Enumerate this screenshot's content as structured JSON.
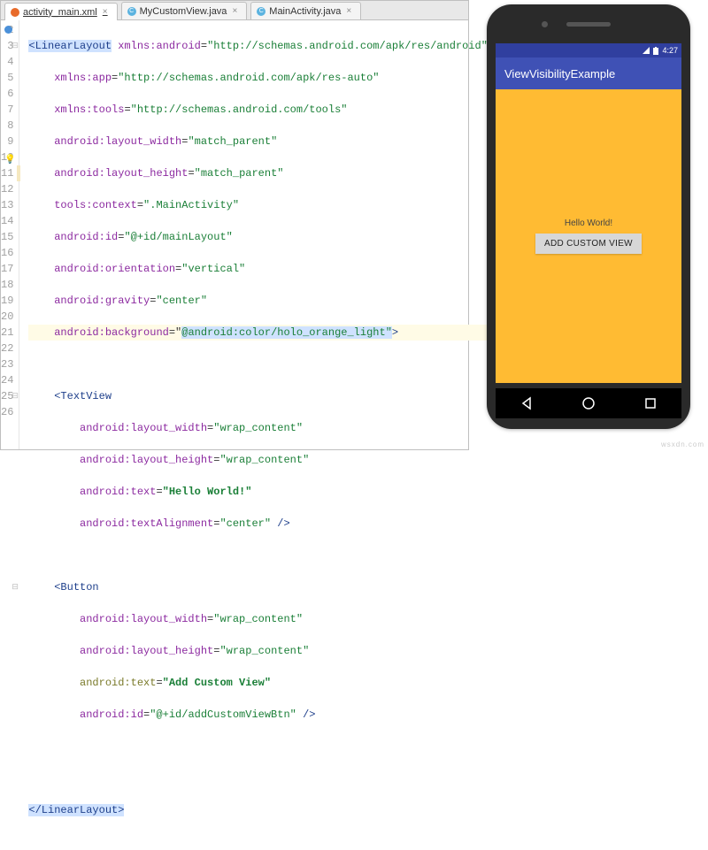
{
  "tabs": [
    {
      "label": "activity_main.xml",
      "icon": "xml",
      "active": true,
      "closable": true
    },
    {
      "label": "MyCustomView.java",
      "icon": "java",
      "active": false,
      "closable": true
    },
    {
      "label": "MainActivity.java",
      "icon": "java",
      "active": false,
      "closable": true
    }
  ],
  "gutter_start": 2,
  "gutter_end": 26,
  "code": {
    "l2": {
      "open": "<LinearLayout",
      "a1": "xmlns:android",
      "v1": "\"http://schemas.android.com/apk/res/android\""
    },
    "l3": {
      "a": "xmlns:app",
      "v": "\"http://schemas.android.com/apk/res-auto\""
    },
    "l4": {
      "a": "xmlns:tools",
      "v": "\"http://schemas.android.com/tools\""
    },
    "l5": {
      "a": "android:layout_width",
      "v": "\"match_parent\""
    },
    "l6": {
      "a": "android:layout_height",
      "v": "\"match_parent\""
    },
    "l7": {
      "a": "tools:context",
      "v": "\".MainActivity\""
    },
    "l8": {
      "a": "android:id",
      "v": "\"@+id/mainLayout\""
    },
    "l9": {
      "a": "android:orientation",
      "v": "\"vertical\""
    },
    "l10": {
      "a": "android:gravity",
      "v": "\"center\""
    },
    "l11": {
      "a": "android:background",
      "eq": "=\"",
      "v": "@android:color/holo_orange_light\"",
      "tail": ">"
    },
    "l13": {
      "open": "<TextView"
    },
    "l14": {
      "a": "android:layout_width",
      "v": "\"wrap_content\""
    },
    "l15": {
      "a": "android:layout_height",
      "v": "\"wrap_content\""
    },
    "l16": {
      "a": "android:text",
      "v": "\"Hello World!\""
    },
    "l17": {
      "a": "android:textAlignment",
      "v": "\"center\"",
      "end": " />"
    },
    "l19": {
      "open": "<Button"
    },
    "l20": {
      "a": "android:layout_width",
      "v": "\"wrap_content\""
    },
    "l21": {
      "a": "android:layout_height",
      "v": "\"wrap_content\""
    },
    "l22": {
      "a": "android:text",
      "v": "\"Add Custom View\""
    },
    "l23": {
      "a": "android:id",
      "v": "\"@+id/addCustomViewBtn\"",
      "end": " />"
    },
    "l26": {
      "close": "</LinearLayout>"
    }
  },
  "phone": {
    "status_time": "4:27",
    "app_title": "ViewVisibilityExample",
    "hello_text": "Hello World!",
    "button_text": "ADD CUSTOM VIEW"
  },
  "watermark": "wsxdn.com"
}
